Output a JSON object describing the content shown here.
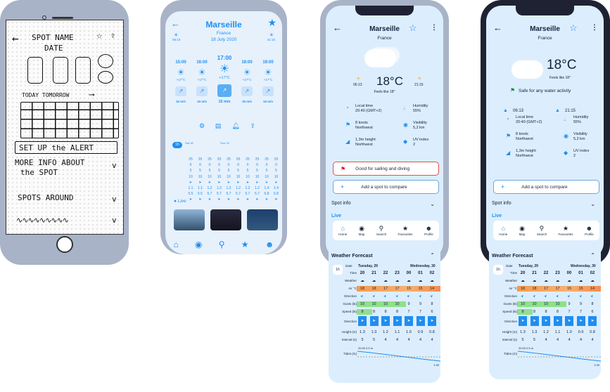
{
  "sketch": {
    "spot_name": "SPOT NAME",
    "date": "DATE",
    "today_tomorrow": "TODAY  TOMORROW",
    "alert": "SET UP the ALERT",
    "more_info": "MORE INFO ABOUT",
    "the_spot": "the SPOT",
    "spots_around": "SPOTS AROUND"
  },
  "wire": {
    "city": "Marseille",
    "country": "France",
    "date": "18 July 2020",
    "sunrise": "06:13",
    "sunset": "21:15",
    "hours": [
      "15:00",
      "16:00",
      "17:00",
      "18:00",
      "19:00"
    ],
    "temps": [
      "+17°C",
      "+17°C",
      "+17°C",
      "+17°C",
      "+17°C"
    ],
    "winds": [
      "15 m/s",
      "15 m/s",
      "15 m/s",
      "15 m/s",
      "15 m/s"
    ],
    "table_tab": "1h",
    "day1": "Sat 18",
    "day2": "Sun 19",
    "live_label": "Live"
  },
  "app": {
    "city": "Marseille",
    "country": "France",
    "temp": "18°C",
    "feels_like": "Feels like 18°",
    "sunrise": "06:13",
    "sunset": "21:15",
    "local_time_label": "Local time",
    "local_time_value": "20:40 (GMT+2)",
    "humidity_label": "Humidity",
    "humidity_value": "55%",
    "wind_label": "8 knots",
    "wind_dir": "Northwest",
    "visibility_label": "Visibility",
    "visibility_value": "5,2 km",
    "wave_label": "1,3m height",
    "wave_dir": "Northwest",
    "uv_label": "UV index",
    "uv_value": "2",
    "good_sailing": "Good for sailing and diving",
    "safe_water": "Safe for any water activity",
    "add_spot": "Add a spot to compare",
    "spot_info": "Spot info",
    "live": "Live",
    "nav": [
      "Home",
      "Map",
      "Search",
      "Favourites",
      "Profile"
    ],
    "forecast_title": "Weather Forecast",
    "tab_1h": "1h",
    "date_label": "Date",
    "day1": "Tuesday, 29",
    "day2": "Wednesday, 30",
    "time_label": "Time",
    "times": [
      "20",
      "21",
      "22",
      "23",
      "00",
      "01",
      "02"
    ],
    "weather_label": "Weather",
    "air_label": "Air °C",
    "air": [
      "18",
      "18",
      "17",
      "17",
      "15",
      "15",
      "14"
    ],
    "direction_label": "Direction",
    "gusts_label": "Gusts (kt)",
    "gusts": [
      "10",
      "10",
      "10",
      "10",
      "9",
      "9",
      "8"
    ],
    "speed_label": "Speed (kt)",
    "speed": [
      "8",
      "8",
      "8",
      "8",
      "7",
      "7",
      "6"
    ],
    "wave_direction_label": "Direction",
    "height_label": "Height (m)",
    "height": [
      "1.3",
      "1.3",
      "1.2",
      "1.1",
      "1.0",
      "0.9",
      "0.8"
    ],
    "interval_label": "Interval (s)",
    "interval": [
      "5",
      "5",
      "4",
      "4",
      "4",
      "4",
      "4"
    ],
    "tides_label": "Tides (m)",
    "tide_start": "20:00 0.5 m",
    "tide_end": "1:30"
  },
  "colors": {
    "accent": "#1f8ef1",
    "air_orange": "#f5a05a",
    "gust_green": "#8fe08a",
    "dark_frame": "#1e2233",
    "light_frame": "#a8b3c8"
  }
}
